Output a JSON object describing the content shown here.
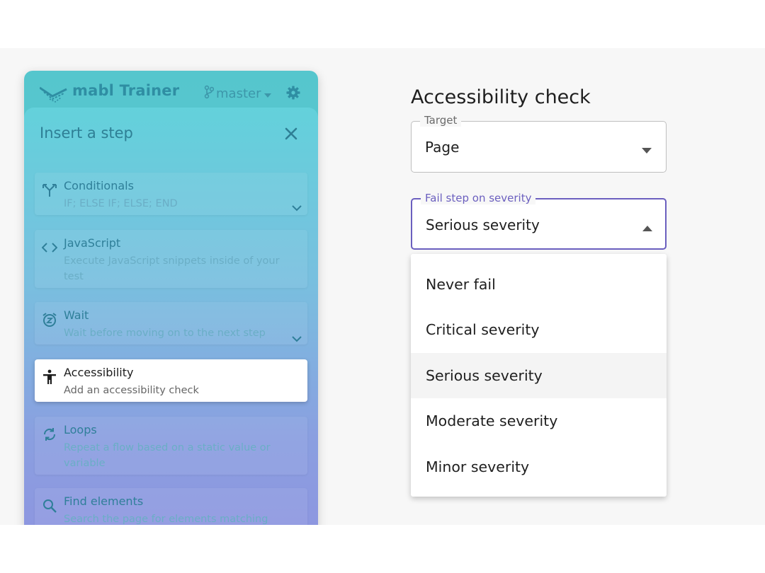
{
  "trainer": {
    "app_title": "mabl Trainer",
    "branch": "master",
    "icons": {
      "logo": "mabl-logo",
      "branch": "git-branch-icon",
      "settings": "gear-icon"
    }
  },
  "drawer": {
    "title": "Insert a step",
    "close_icon": "close-icon",
    "steps": [
      {
        "title": "Conditionals",
        "description": "IF; ELSE IF; ELSE; END",
        "icon": "branch-split-icon",
        "expandable": true
      },
      {
        "title": "JavaScript",
        "description": "Execute JavaScript snippets inside of your test",
        "icon": "code-icon",
        "expandable": false
      },
      {
        "title": "Wait",
        "description": "Wait before moving on to the next step",
        "icon": "snooze-alarm-icon",
        "expandable": true
      },
      {
        "title": "Accessibility",
        "description": "Add an accessibility check",
        "icon": "accessibility-person-icon",
        "expandable": false,
        "active": true
      },
      {
        "title": "Loops",
        "description": "Repeat a flow based on a static value or variable",
        "icon": "loop-icon",
        "expandable": false
      },
      {
        "title": "Find elements",
        "description": "Search the page for elements matching",
        "icon": "search-icon",
        "expandable": false
      }
    ]
  },
  "form": {
    "title": "Accessibility check",
    "target": {
      "label": "Target",
      "value": "Page"
    },
    "severity": {
      "label": "Fail step on severity",
      "value": "Serious severity",
      "options": [
        "Never fail",
        "Critical severity",
        "Serious severity",
        "Moderate severity",
        "Minor severity"
      ]
    }
  },
  "colors": {
    "accent": "#6b5fbf",
    "panel_teal": "#55c6cd",
    "panel_purple": "#8e95e0"
  }
}
